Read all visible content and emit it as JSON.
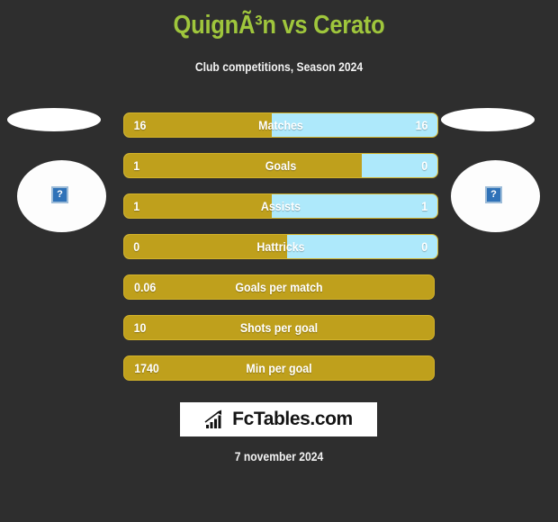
{
  "header": {
    "title": "QuignÃ³n vs Cerato",
    "subtitle": "Club competitions, Season 2024"
  },
  "players": {
    "left": {
      "placeholder_glyph": "?"
    },
    "right": {
      "placeholder_glyph": "?"
    }
  },
  "colors": {
    "background": "#2e2e2e",
    "title": "#9fc63c",
    "bar_left": "#bfa01c",
    "bar_right": "#aee9fb",
    "bar_border": "#d4b32a",
    "text": "#ffffff"
  },
  "chart_data": {
    "type": "bar",
    "title": "QuignÃ³n vs Cerato",
    "subtitle": "Club competitions, Season 2024",
    "categories": [
      "Matches",
      "Goals",
      "Assists",
      "Hattricks",
      "Goals per match",
      "Shots per goal",
      "Min per goal"
    ],
    "series": [
      {
        "name": "QuignÃ³n",
        "values": [
          "16",
          "1",
          "1",
          "0",
          "0.06",
          "10",
          "1740"
        ]
      },
      {
        "name": "Cerato",
        "values": [
          "16",
          "0",
          "1",
          "0",
          null,
          null,
          null
        ]
      }
    ],
    "legend_position": "none",
    "grid": false
  },
  "stats": [
    {
      "label": "Matches",
      "left": "16",
      "right": "16",
      "split": 47,
      "split_bar": true
    },
    {
      "label": "Goals",
      "left": "1",
      "right": "0",
      "split": 76,
      "split_bar": true
    },
    {
      "label": "Assists",
      "left": "1",
      "right": "1",
      "split": 47,
      "split_bar": true
    },
    {
      "label": "Hattricks",
      "left": "0",
      "right": "0",
      "split": 52,
      "split_bar": true
    },
    {
      "label": "Goals per match",
      "left": "0.06",
      "right": "",
      "split": 100,
      "split_bar": false
    },
    {
      "label": "Shots per goal",
      "left": "10",
      "right": "",
      "split": 100,
      "split_bar": false
    },
    {
      "label": "Min per goal",
      "left": "1740",
      "right": "",
      "split": 100,
      "split_bar": false
    }
  ],
  "footer": {
    "logo_text": "FcTables.com",
    "logo_icon": "bar-chart-trend-icon",
    "date": "7 november 2024"
  }
}
